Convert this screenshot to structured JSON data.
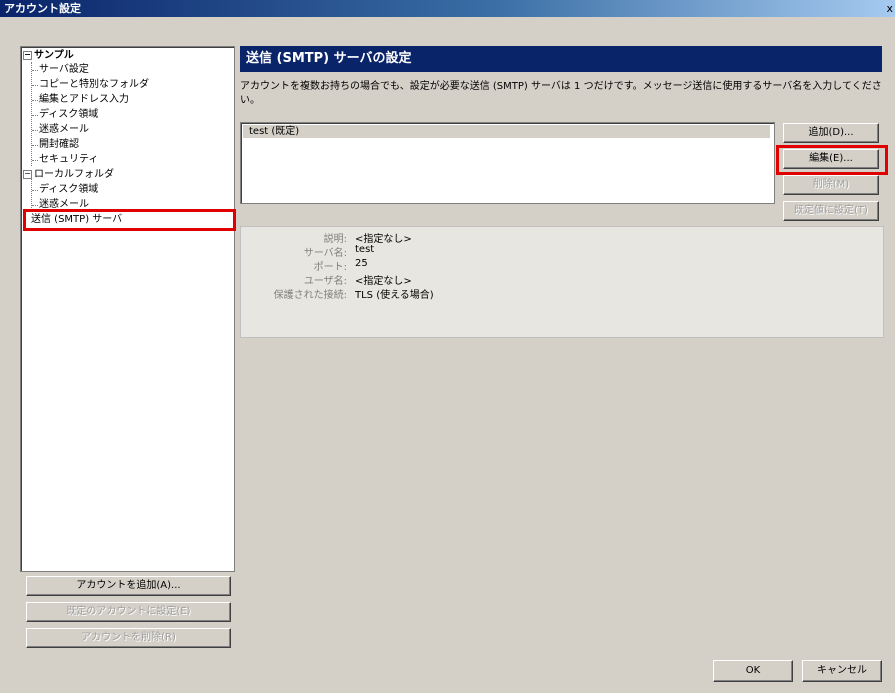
{
  "window": {
    "title": "アカウント設定",
    "close_glyph": "x"
  },
  "tree": {
    "account_sample": "サンプル",
    "sample_items": [
      "サーバ設定",
      "コピーと特別なフォルダ",
      "編集とアドレス入力",
      "ディスク領域",
      "迷惑メール",
      "開封確認",
      "セキュリティ"
    ],
    "account_local": "ローカルフォルダ",
    "local_items": [
      "ディスク領域",
      "迷惑メール"
    ],
    "smtp_item": "送信 (SMTP) サーバ",
    "expander_glyph": "−"
  },
  "left_buttons": {
    "add_account": "アカウントを追加(A)...",
    "set_default": "既定のアカウントに設定(E)",
    "remove_account": "アカウントを削除(R)"
  },
  "panel": {
    "title": "送信 (SMTP) サーバの設定",
    "description": "アカウントを複数お持ちの場合でも、設定が必要な送信 (SMTP) サーバは 1 つだけです。メッセージ送信に使用するサーバ名を入力してください。",
    "servers": [
      "test (既定)"
    ],
    "buttons": {
      "add": "追加(D)...",
      "edit": "編集(E)...",
      "delete": "削除(M)",
      "set_default": "既定値に設定(T)"
    },
    "details": {
      "labels": [
        "説明:",
        "サーバ名:",
        "ポート:",
        "ユーザ名:",
        "保護された接続:"
      ],
      "values": [
        "<指定なし>",
        "test",
        "25",
        "<指定なし>",
        "TLS (使える場合)"
      ]
    }
  },
  "footer": {
    "ok": "OK",
    "cancel": "キャンセル"
  },
  "colors": {
    "highlight": "#e00000",
    "header_bg": "#0a246a",
    "dialog_bg": "#d4d0c8"
  }
}
